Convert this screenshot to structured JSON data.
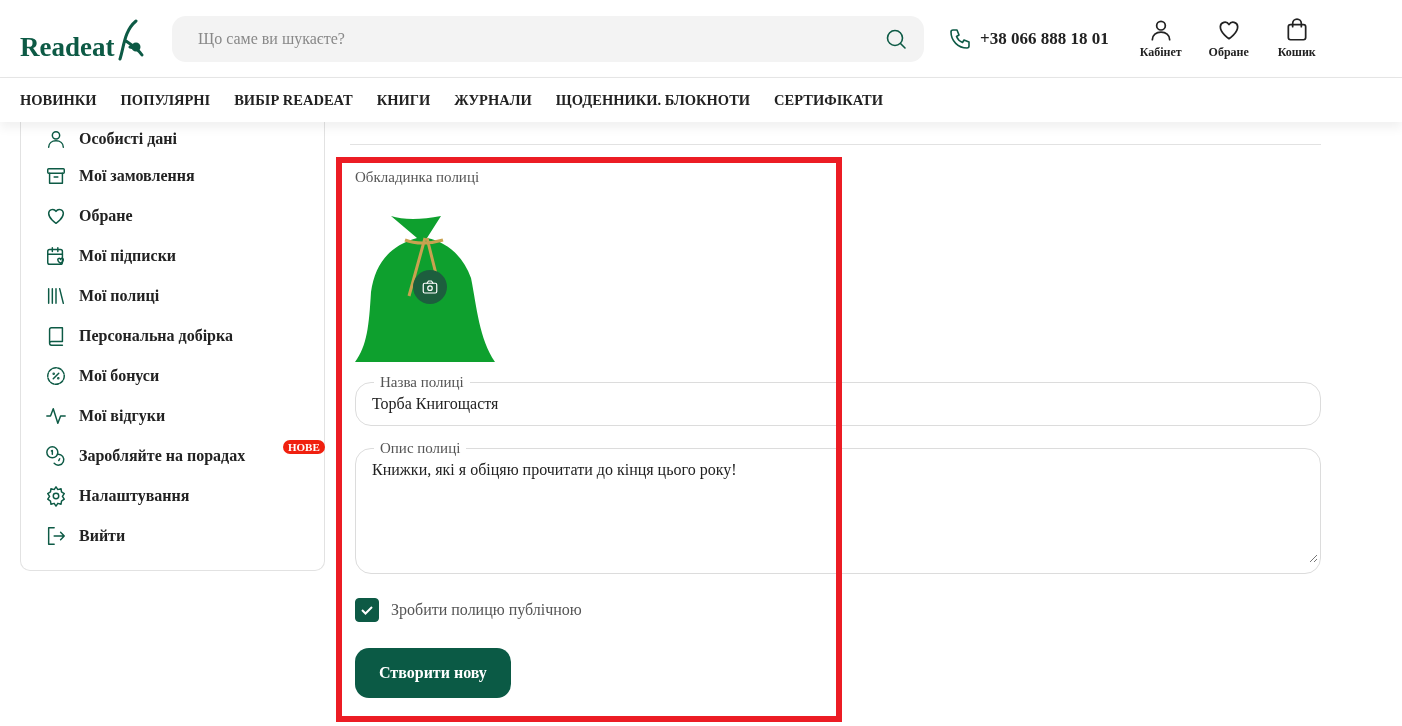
{
  "header": {
    "logo": "Readeat",
    "search": {
      "placeholder": "Що саме ви шукаєте?"
    },
    "phone": "+38 066 888 18 01",
    "actions": [
      {
        "kind": "user",
        "label": "Кабінет"
      },
      {
        "kind": "heart",
        "label": "Обране"
      },
      {
        "kind": "bag",
        "label": "Кошик"
      }
    ]
  },
  "nav": [
    "НОВИНКИ",
    "ПОПУЛЯРНІ",
    "ВИБІР READEAT",
    "КНИГИ",
    "ЖУРНАЛИ",
    "ЩОДЕННИКИ. БЛОКНОТИ",
    "СЕРТИФІКАТИ"
  ],
  "sidebar": {
    "items": [
      {
        "kind": "user",
        "label": "Особисті дані"
      },
      {
        "kind": "archive",
        "label": "Мої замовлення"
      },
      {
        "kind": "heart",
        "label": "Обране"
      },
      {
        "kind": "calendar",
        "label": "Мої підписки"
      },
      {
        "kind": "shelf",
        "label": "Мої полиці"
      },
      {
        "kind": "book",
        "label": "Персональна добірка"
      },
      {
        "kind": "discount",
        "label": "Мої бонуси"
      },
      {
        "kind": "pulse",
        "label": "Мої відгуки"
      },
      {
        "kind": "coins",
        "label": "Заробляйте на порадах",
        "badge": "НОВЕ"
      },
      {
        "kind": "gear",
        "label": "Налаштування"
      },
      {
        "kind": "logout",
        "label": "Вийти"
      }
    ]
  },
  "form": {
    "cover_label": "Обкладинка полиці",
    "name_field": {
      "label": "Назва полиці",
      "value": "Торба Книгощастя"
    },
    "description_field": {
      "label": "Опис полиці",
      "value": "Книжки, які я обіцяю прочитати до кінця цього року!"
    },
    "public_checkbox": {
      "label": "Зробити полицю публічною",
      "checked": true
    },
    "submit": "Створити нову"
  }
}
